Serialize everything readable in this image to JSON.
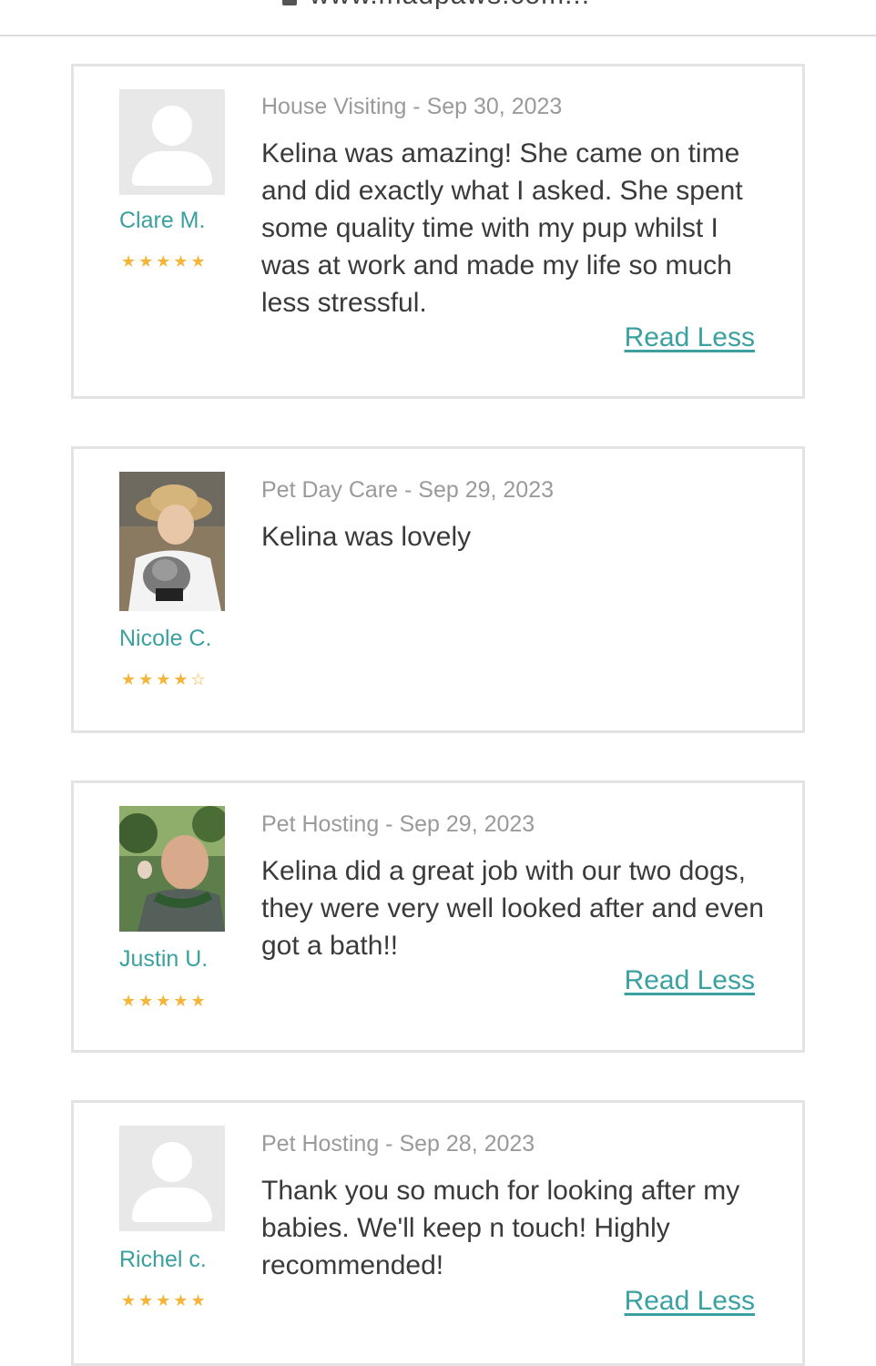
{
  "browser": {
    "url": "www.madpaws.com..."
  },
  "reviews": [
    {
      "name": "Clare M.",
      "rating": 5,
      "stars": "★★★★★",
      "service_date": "House Visiting - Sep 30, 2023",
      "text": "Kelina was amazing! She came on time and did exactly what I asked. She spent some quality time with my pup whilst I was at work and made my life so much less stressful.",
      "action": "Read Less",
      "avatar_type": "placeholder"
    },
    {
      "name": "Nicole C.",
      "rating": 4,
      "stars": "★★★★☆",
      "service_date": "Pet Day Care - Sep 29, 2023",
      "text": "Kelina was lovely",
      "avatar_type": "photo"
    },
    {
      "name": "Justin U.",
      "rating": 5,
      "stars": "★★★★★",
      "service_date": "Pet Hosting - Sep 29, 2023",
      "text": "Kelina did a great job with our two dogs, they were very well looked after and even got a bath!!",
      "action": "Read Less",
      "avatar_type": "photo"
    },
    {
      "name": "Richel c.",
      "rating": 5,
      "stars": "★★★★★",
      "service_date": "Pet Hosting - Sep 28, 2023",
      "text": "Thank you so much for looking after my babies. We'll keep n touch! Highly recommended!",
      "action": "Read Less",
      "avatar_type": "placeholder"
    }
  ],
  "colors": {
    "accent": "#3aa0a0",
    "star": "#f4b53a",
    "border": "#e3e3e3",
    "meta_text": "#9a9a9a"
  }
}
